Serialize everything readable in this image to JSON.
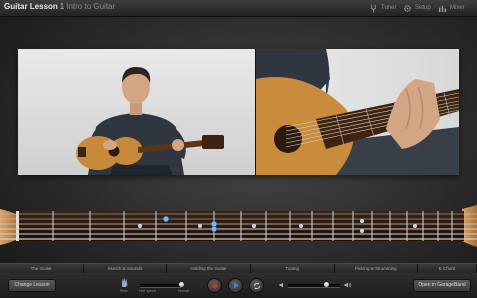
{
  "window": {
    "title": "Guitar Lesson",
    "lesson_number": "1",
    "lesson_subtitle": "Intro to Guitar"
  },
  "toolbar": {
    "tuner_label": "Tuner",
    "setup_label": "Setup",
    "mixer_label": "Mixer"
  },
  "tabs": [
    {
      "label": "The Guitar",
      "active": false
    },
    {
      "label": "Sketch & Sounds",
      "active": false
    },
    {
      "label": "Holding the Guitar",
      "active": false
    },
    {
      "label": "Tuning",
      "active": false
    },
    {
      "label": "Picking & Strumming",
      "active": false
    },
    {
      "label": "E Chord",
      "active": false
    }
  ],
  "controls": {
    "change_lesson_label": "Change Lesson",
    "open_garageband_label": "Open in GarageBand",
    "speed_label": "Slow",
    "speed_slider_label": "Half speed",
    "speed_normal_label": "Normal",
    "speed_value": 0.0,
    "volume_value": 0.75
  },
  "colors": {
    "accent_blue": "#3c8cdc",
    "record_red": "#c0392b",
    "fret_dot": "#cfd6dc",
    "finger_marker": "#7ab8f0"
  },
  "icons": {
    "tuner": "tuning-fork-icon",
    "setup": "gear-icon",
    "mixer": "mixer-bars-icon",
    "record": "record-icon",
    "play": "play-icon",
    "loop": "loop-icon",
    "volume_low": "speaker-low-icon",
    "volume_high": "speaker-high-icon",
    "speed": "hand-icon"
  }
}
